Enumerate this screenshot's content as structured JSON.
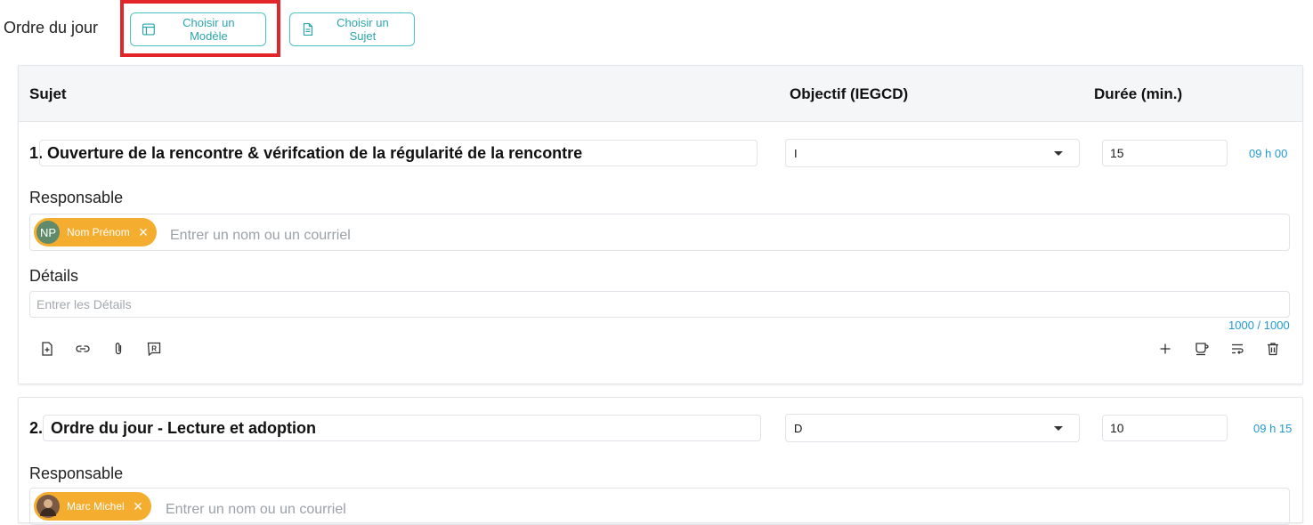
{
  "header": {
    "title": "Ordre du jour",
    "choose_template_label": "Choisir un Modèle",
    "choose_subject_label": "Choisir un Sujet"
  },
  "table": {
    "col_subject": "Sujet",
    "col_objective": "Objectif (IEGCD)",
    "col_duration": "Durée (min.)"
  },
  "items": [
    {
      "number": "1.",
      "subject": "Ouverture de la rencontre & vérifcation de la régularité de la rencontre",
      "objective": "I",
      "duration": "15",
      "time": "09 h 00",
      "responsible_label": "Responsable",
      "responsible": {
        "initials": "NP",
        "name": "Nom Prénom"
      },
      "people_placeholder": "Entrer un nom ou un courriel",
      "details_label": "Détails",
      "details_placeholder": "Entrer les Détails",
      "counter": "1000 / 1000"
    },
    {
      "number": "2.",
      "subject": "Ordre du jour - Lecture et adoption",
      "objective": "D",
      "duration": "10",
      "time": "09 h 15",
      "responsible_label": "Responsable",
      "responsible": {
        "name": "Marc Michel"
      },
      "people_placeholder": "Entrer un nom ou un courriel"
    }
  ],
  "colors": {
    "accent": "#2aa6ad",
    "chip": "#f5ad2f",
    "time": "#1f9ad6",
    "highlight": "#e1252b"
  }
}
